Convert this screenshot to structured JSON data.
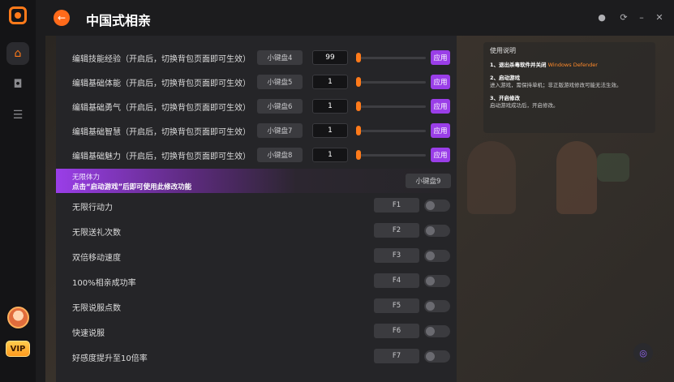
{
  "app": {
    "title": "中国式相亲"
  },
  "window_controls": [
    {
      "name": "theme-icon",
      "glyph": "●"
    },
    {
      "name": "settings-icon",
      "glyph": "⟳"
    },
    {
      "name": "minimize-icon",
      "glyph": "–"
    },
    {
      "name": "close-icon",
      "glyph": "✕"
    }
  ],
  "sidebar": {
    "vip_label": "VIP"
  },
  "edit_rows": [
    {
      "label": "编辑技能经验（开启后，切换背包页面即可生效）",
      "key": "小键盘4",
      "value": "99",
      "apply": "应用"
    },
    {
      "label": "编辑基础体能（开启后，切换背包页面即可生效）",
      "key": "小键盘5",
      "value": "1",
      "apply": "应用"
    },
    {
      "label": "编辑基础勇气（开启后，切换背包页面即可生效）",
      "key": "小键盘6",
      "value": "1",
      "apply": "应用"
    },
    {
      "label": "编辑基础智慧（开启后，切换背包页面即可生效）",
      "key": "小键盘7",
      "value": "1",
      "apply": "应用"
    },
    {
      "label": "编辑基础魅力（开启后，切换背包页面即可生效）",
      "key": "小键盘8",
      "value": "1",
      "apply": "应用"
    }
  ],
  "banner": {
    "title": "无限体力",
    "hint": "点击“启动游戏”后即可使用此修改功能",
    "key": "小键盘9"
  },
  "toggle_rows": [
    {
      "label": "无限行动力",
      "key": "F1"
    },
    {
      "label": "无限送礼次数",
      "key": "F2"
    },
    {
      "label": "双倍移动速度",
      "key": "F3"
    },
    {
      "label": "100%相亲成功率",
      "key": "F4"
    },
    {
      "label": "无限说服点数",
      "key": "F5"
    },
    {
      "label": "快速说服",
      "key": "F6"
    },
    {
      "label": "好感度提升至10倍率",
      "key": "F7"
    }
  ],
  "info": {
    "heading": "使用说明",
    "step1_title": "1、退出杀毒软件并关闭",
    "step1_highlight": "Windows Defender",
    "step2_title": "2、启动游戏",
    "step2_body": "进入游戏，需保持单机；非正版游戏修改可能无法生效。",
    "step3_title": "3、开启修改",
    "step3_body": "启动游戏成功后，开启修改。"
  }
}
